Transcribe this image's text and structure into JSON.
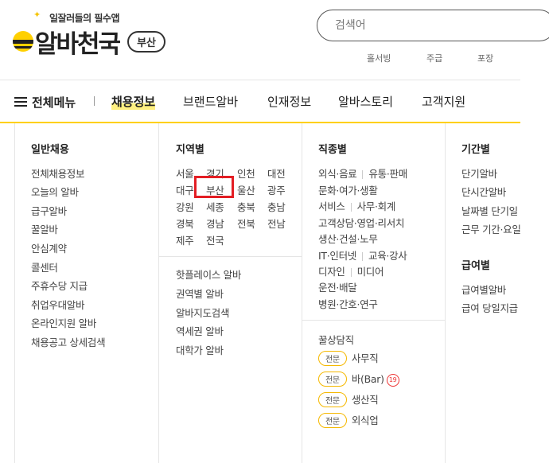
{
  "header": {
    "tagline": "일잘러들의 필수앱",
    "logo": "알바천국",
    "region": "부산",
    "search_placeholder": "검색어",
    "quick_links": [
      "홀서빙",
      "주급",
      "포장"
    ]
  },
  "gnb": {
    "all_menu": "전체메뉴",
    "items": [
      "채용정보",
      "브랜드알바",
      "인재정보",
      "알바스토리",
      "고객지원"
    ]
  },
  "panel": {
    "general": {
      "title": "일반채용",
      "items": [
        "전체채용정보",
        "오늘의 알바",
        "급구알바",
        "꿀알바",
        "안심계약",
        "콜센터",
        "주휴수당 지급",
        "취업우대알바",
        "온라인지원 알바",
        "채용공고 상세검색"
      ]
    },
    "region": {
      "title": "지역별",
      "grid": [
        [
          "서울",
          "경기",
          "인천",
          "대전"
        ],
        [
          "대구",
          "부산",
          "울산",
          "광주"
        ],
        [
          "강원",
          "세종",
          "충북",
          "충남"
        ],
        [
          "경북",
          "경남",
          "전북",
          "전남"
        ],
        [
          "제주",
          "전국"
        ]
      ],
      "extra": [
        "핫플레이스 알바",
        "권역별 알바",
        "알바지도검색",
        "역세권 알바",
        "대학가 알바"
      ]
    },
    "job": {
      "title": "직종별",
      "rows": [
        [
          "외식·음료",
          "유통·판매"
        ],
        [
          "문화·여가·생활"
        ],
        [
          "서비스",
          "사무·회계"
        ],
        [
          "고객상담·영업·리서치"
        ],
        [
          "생산·건설·노무"
        ],
        [
          "IT·인터넷",
          "교육·강사"
        ],
        [
          "디자인",
          "미디어"
        ],
        [
          "운전·배달"
        ],
        [
          "병원·간호·연구"
        ]
      ],
      "honey_title": "꿀상담직",
      "chip_label": "전문",
      "specials": [
        "사무직",
        "바(Bar)",
        "생산직",
        "외식업"
      ],
      "age_badge": "19"
    },
    "period": {
      "title": "기간별",
      "items": [
        "단기알바",
        "단시간알바",
        "날짜별 단기일",
        "근무 기간·요일"
      ]
    },
    "pay": {
      "title": "급여별",
      "items": [
        "급여별알바",
        "급여 당일지급"
      ]
    }
  }
}
